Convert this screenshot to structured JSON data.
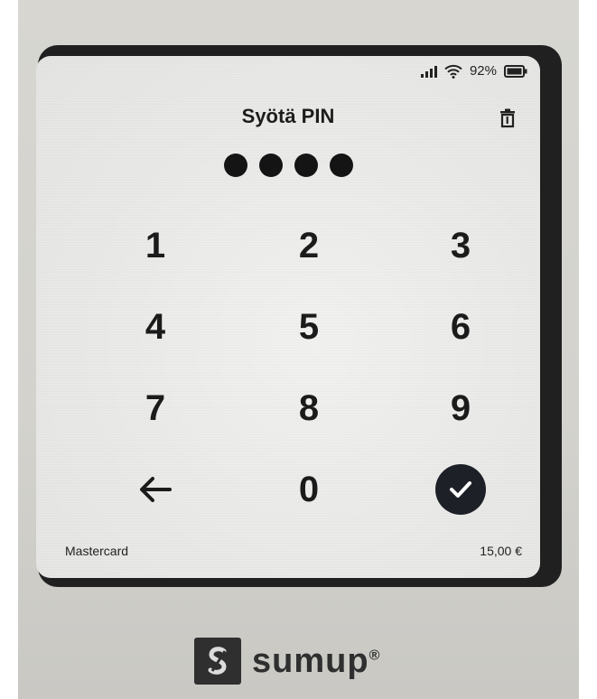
{
  "status": {
    "battery": "92%",
    "signal_icon": "signal-icon",
    "wifi_icon": "wifi-icon",
    "battery_icon": "battery-icon"
  },
  "screen": {
    "title": "Syötä PIN",
    "pin_entered_count": 4
  },
  "keypad": {
    "keys": [
      "1",
      "2",
      "3",
      "4",
      "5",
      "6",
      "7",
      "8",
      "9",
      "0"
    ],
    "back_icon": "arrow-left-icon",
    "confirm_icon": "checkmark-icon",
    "clear_icon": "trash-icon"
  },
  "footer": {
    "card": "Mastercard",
    "amount": "15,00 €"
  },
  "brand": {
    "name": "sumup",
    "mark": "®"
  },
  "colors": {
    "text": "#1b1b1b",
    "confirm_bg": "#1d2026",
    "screen_bg": "#ececea"
  }
}
